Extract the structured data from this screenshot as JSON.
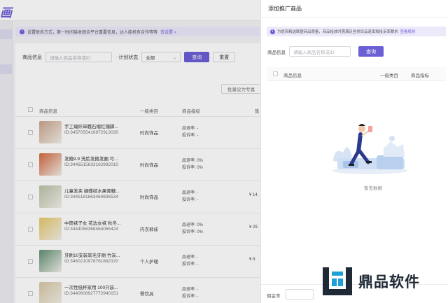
{
  "app": {
    "brand": "画",
    "notice": "设置联系方式，第一时间接收团合平台重要信息，达人能机有合作等等",
    "notice_link": "去设置 >"
  },
  "filters": {
    "product_label": "商品信息",
    "product_placeholder": "请输入商品名称或ID",
    "plan_status_label": "· 计划状态",
    "plan_status_value": "全部",
    "query_button": "查询",
    "reset_button": "重置",
    "batch_button": "批量设为专属"
  },
  "table": {
    "headers": [
      "商品信息",
      "一级类目",
      "商品指标",
      "售"
    ],
    "rows": [
      {
        "name": "手工编织单戳石榴红镯脚...",
        "id": "ID:3457055416972913030",
        "category": "时尚饰品",
        "metric1": "品退率: -",
        "metric2": "投诉率: -",
        "price": "",
        "thumb": "#c9a48c"
      },
      {
        "name": "发箍9.9 洗脸发箍发圈 可...",
        "id": "ID:3446515633162992010",
        "category": "时尚饰品",
        "metric1": "品退率: 0%",
        "metric2": "投诉率: 0%",
        "price": "",
        "thumb": "#d2683e"
      },
      {
        "name": "儿童发夹 蝴蝶结水果膏糖...",
        "id": "ID:3445181663464836534",
        "category": "时尚饰品",
        "metric1": "品退率: -",
        "metric2": "投诉率: -",
        "price": "¥ 14.",
        "thumb": "#b9c3a6"
      },
      {
        "name": "中筒袜子女 花边女袜 秋冬...",
        "id": "ID:3444058368464065424",
        "category": "内衣裤袜",
        "metric1": "品退率: 0%",
        "metric2": "投诉率: 0%",
        "price": "¥ 29.",
        "thumb": "#e5c86a"
      },
      {
        "name": "牙刷10支装软毛牙刷 竹炭...",
        "id": "ID:3460210978761882320",
        "category": "个人护理",
        "metric1": "品退率: -",
        "metric2": "投诉率: -",
        "price": "¥ 9.",
        "thumb": "#5e8f73"
      },
      {
        "name": "一次性纸杯家用 100只装...",
        "id": "ID:3440608927772940151",
        "category": "餐饮具",
        "metric1": "品退率: -",
        "metric2": "投诉率: -",
        "price": "",
        "thumb": "#d7c7a4"
      }
    ]
  },
  "drawer": {
    "title": "添加推广商品",
    "notice": "为提高精选联盟商品质量，商品投放时需满足各类目品退率和投诉率要求",
    "notice_link": "查看规则",
    "product_label": "商品信息",
    "product_placeholder": "请输入商品名称或ID",
    "query_button": "查询",
    "headers": [
      "商品信息",
      "一级类目",
      "商品指标"
    ],
    "empty_text": "暂无数据",
    "footer_label": "佣金率"
  },
  "watermark": {
    "text": "鼎品软件"
  },
  "colors": {
    "accent": "#6b5fd6",
    "notice_bg": "#ece9fb"
  }
}
